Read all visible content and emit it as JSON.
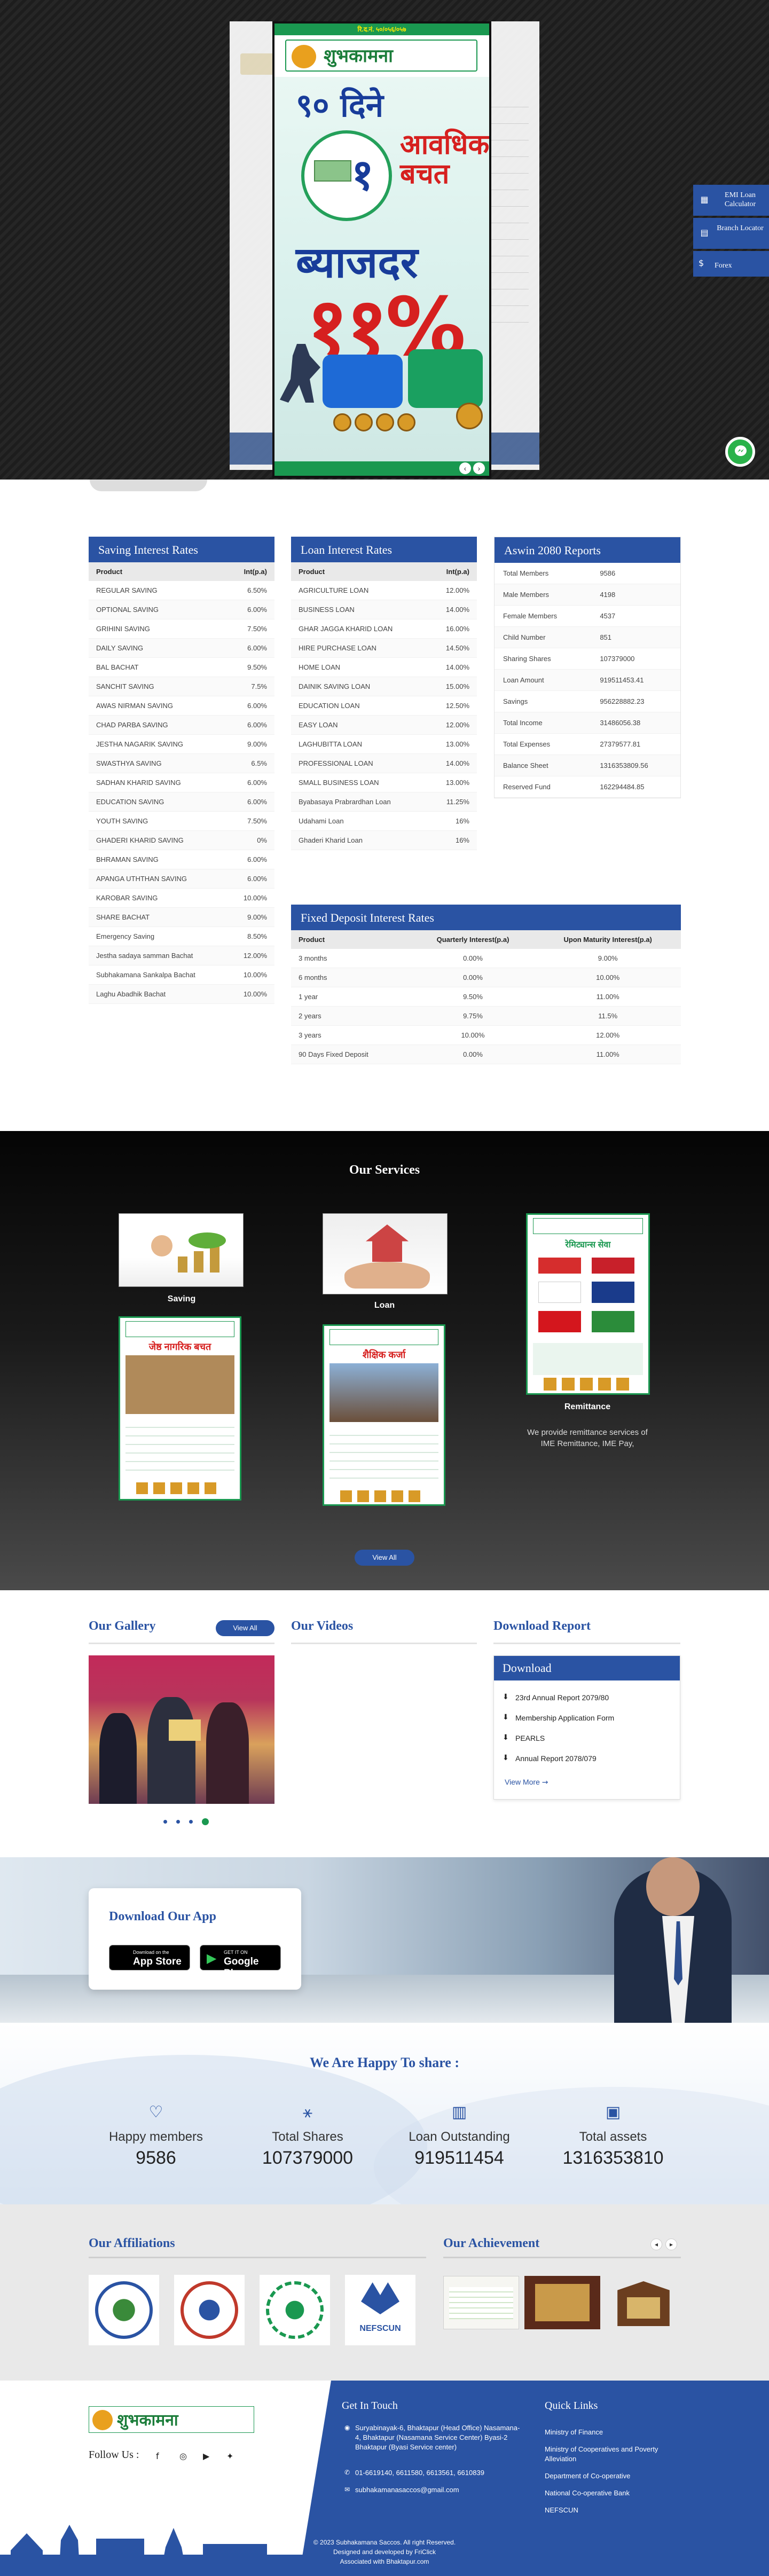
{
  "hero": {
    "poster_header": "रि.द.नं.",
    "poster_header_num": "५०/०५६/०५७",
    "poster_name": "शुभकामना",
    "poster_days": "९० दिने",
    "poster_count": "१",
    "poster_saving": "आवधिक बचत",
    "poster_rate_label": "ब्याजदर",
    "poster_rate": "११%"
  },
  "side": {
    "emi": "EMI Loan Calculator",
    "branch": "Branch Locator",
    "forex": "Forex"
  },
  "saving": {
    "title": "Saving Interest Rates",
    "col_product": "Product",
    "col_rate": "Int(p.a)",
    "rows": [
      [
        "REGULAR SAVING",
        "6.50%"
      ],
      [
        "OPTIONAL SAVING",
        "6.00%"
      ],
      [
        "GRIHINI SAVING",
        "7.50%"
      ],
      [
        "DAILY SAVING",
        "6.00%"
      ],
      [
        "BAL BACHAT",
        "9.50%"
      ],
      [
        "SANCHIT SAVING",
        "7.5%"
      ],
      [
        "AWAS NIRMAN SAVING",
        "6.00%"
      ],
      [
        "CHAD PARBA SAVING",
        "6.00%"
      ],
      [
        "JESTHA NAGARIK SAVING",
        "9.00%"
      ],
      [
        "SWASTHYA SAVING",
        "6.5%"
      ],
      [
        "SADHAN KHARID SAVING",
        "6.00%"
      ],
      [
        "EDUCATION SAVING",
        "6.00%"
      ],
      [
        "YOUTH SAVING",
        "7.50%"
      ],
      [
        "GHADERI KHARID SAVING",
        "0%"
      ],
      [
        "BHRAMAN SAVING",
        "6.00%"
      ],
      [
        "APANGA UTHTHAN SAVING",
        "6.00%"
      ],
      [
        "KAROBAR SAVING",
        "10.00%"
      ],
      [
        "SHARE BACHAT",
        "9.00%"
      ],
      [
        "Emergency Saving",
        "8.50%"
      ],
      [
        "Jestha sadaya samman Bachat",
        "12.00%"
      ],
      [
        "Subhakamana Sankalpa Bachat",
        "10.00%"
      ],
      [
        "Laghu Abadhik Bachat",
        "10.00%"
      ]
    ]
  },
  "loan": {
    "title": "Loan Interest Rates",
    "col_product": "Product",
    "col_rate": "Int(p.a)",
    "rows": [
      [
        "AGRICULTURE LOAN",
        "12.00%"
      ],
      [
        "BUSINESS LOAN",
        "14.00%"
      ],
      [
        "GHAR JAGGA KHARID LOAN",
        "16.00%"
      ],
      [
        "HIRE PURCHASE LOAN",
        "14.50%"
      ],
      [
        "HOME LOAN",
        "14.00%"
      ],
      [
        "DAINIK SAVING LOAN",
        "15.00%"
      ],
      [
        "EDUCATION LOAN",
        "12.50%"
      ],
      [
        "EASY LOAN",
        "12.00%"
      ],
      [
        "LAGHUBITTA LOAN",
        "13.00%"
      ],
      [
        "PROFESSIONAL LOAN",
        "14.00%"
      ],
      [
        "SMALL BUSINESS LOAN",
        "13.00%"
      ],
      [
        "Byabasaya Prabrardhan Loan",
        "11.25%"
      ],
      [
        "Udahami Loan",
        "16%"
      ],
      [
        "Ghaderi Kharid Loan",
        "16%"
      ]
    ]
  },
  "fixed": {
    "title": "Fixed Deposit Interest Rates",
    "col_product": "Product",
    "col_q": "Quarterly Interest(p.a)",
    "col_m": "Upon Maturity Interest(p.a)",
    "rows": [
      [
        "3 months",
        "0.00%",
        "9.00%"
      ],
      [
        "6 months",
        "0.00%",
        "10.00%"
      ],
      [
        "1 year",
        "9.50%",
        "11.00%"
      ],
      [
        "2 years",
        "9.75%",
        "11.5%"
      ],
      [
        "3 years",
        "10.00%",
        "12.00%"
      ],
      [
        "90 Days Fixed Deposit",
        "0.00%",
        "11.00%"
      ]
    ]
  },
  "reports": {
    "title": "Aswin 2080 Reports",
    "rows": [
      [
        "Total Members",
        "9586"
      ],
      [
        "Male Members",
        "4198"
      ],
      [
        "Female Members",
        "4537"
      ],
      [
        "Child Number",
        "851"
      ],
      [
        "Sharing Shares",
        "107379000"
      ],
      [
        "Loan Amount",
        "919511453.41"
      ],
      [
        "Savings",
        "956228882.23"
      ],
      [
        "Total Income",
        "31486056.38"
      ],
      [
        "Total Expenses",
        "27379577.81"
      ],
      [
        "Balance Sheet",
        "1316353809.56"
      ],
      [
        "Reserved Fund",
        "162294484.85"
      ]
    ]
  },
  "services": {
    "heading": "Our Services",
    "saving_label": "Saving",
    "loan_label": "Loan",
    "remit_label": "Remittance",
    "remit_desc": "We provide remittance services of IME Remittance, IME Pay,",
    "poster_senior": "जेष्ठ नागरिक बचत",
    "poster_edu": "शैक्षिक कर्जा",
    "poster_remit_heading": "रेमिट्यान्स सेवा",
    "view_all": "View All"
  },
  "media": {
    "gallery": "Our Gallery",
    "gallery_view_all": "View All",
    "videos": "Our Videos",
    "download_report": "Download Report",
    "download_box": "Download",
    "items": [
      "23rd Annual Report 2079/80",
      "Membership Application Form",
      "PEARLS",
      "Annual Report 2078/079"
    ],
    "view_more": "View More"
  },
  "app": {
    "title": "Download Our App",
    "appstore_small": "Download on the",
    "appstore_big": "App Store",
    "gplay_small": "GET IT ON",
    "gplay_big": "Google Play"
  },
  "stats": {
    "heading": "We Are Happy To share :",
    "items": [
      {
        "label": "Happy members",
        "value": "9586"
      },
      {
        "label": "Total Shares",
        "value": "107379000"
      },
      {
        "label": "Loan Outstanding",
        "value": "919511454"
      },
      {
        "label": "Total assets",
        "value": "1316353810"
      }
    ]
  },
  "aff": {
    "affiliations": "Our Affiliations",
    "achievement": "Our Achievement",
    "nefscun": "NEFSCUN"
  },
  "footer": {
    "logo_name": "शुभकामना",
    "follow": "Follow Us :",
    "get_in_touch": "Get In Touch",
    "address": "Suryabinayak-6, Bhaktapur (Head Office) Nasamana-4, Bhaktapur (Nasamana Service Center) Byasi-2 Bhaktapur (Byasi Service center)",
    "phone": "01-6619140, 6611580, 6613561, 6610839",
    "email": "subhakamanasaccos@gmail.com",
    "quick_links": "Quick Links",
    "links": [
      "Ministry of Finance",
      "Ministry of Cooperatives and Poverty Alleviation",
      "Department of Co-operative",
      "National Co-operative Bank",
      "NEFSCUN"
    ],
    "copyright": "2023 Subhakamana Saccos. All right Reserved.",
    "designed": "Designed and developed by FriClick",
    "associated": "Associated with Bhaktapur.com"
  }
}
